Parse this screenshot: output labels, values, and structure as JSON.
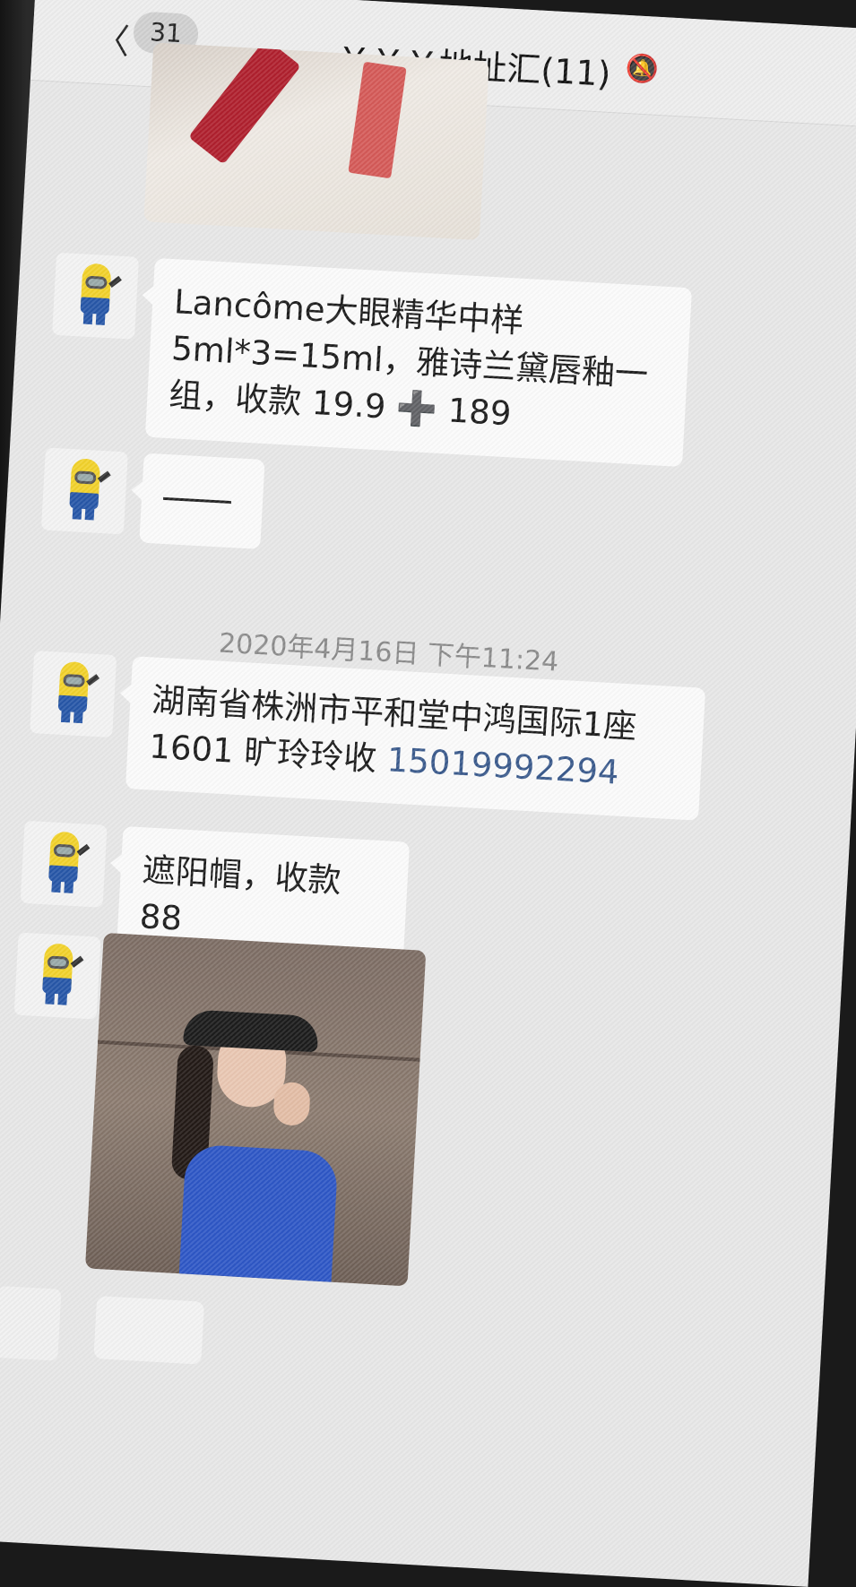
{
  "header": {
    "back_glyph": "〈",
    "unread_count": "31",
    "title": "￥￥￥地址汇(11)",
    "mute_icon": "bell-off-icon"
  },
  "messages": [
    {
      "type": "image",
      "subject": "lipstick-photo"
    },
    {
      "type": "text",
      "text": "Lancôme大眼精华中样5ml*3=15ml，雅诗兰黛唇釉一组，收款 19.9 ➕ 189"
    },
    {
      "type": "text",
      "text": "——"
    },
    {
      "type": "time",
      "text": "2020年4月16日 下午11:24"
    },
    {
      "type": "text",
      "text_prefix": "湖南省株洲市平和堂中鸿国际1座1601 旷玲玲收 ",
      "phone": "15019992294"
    },
    {
      "type": "text",
      "text": "遮阳帽，收款 88"
    },
    {
      "type": "image",
      "subject": "woman-in-visor-photo"
    }
  ],
  "colors": {
    "chat_background": "#e7e7e7",
    "bubble": "#fbfbfb",
    "link": "#3a5a8c",
    "timestamp": "#8a8a8a"
  }
}
